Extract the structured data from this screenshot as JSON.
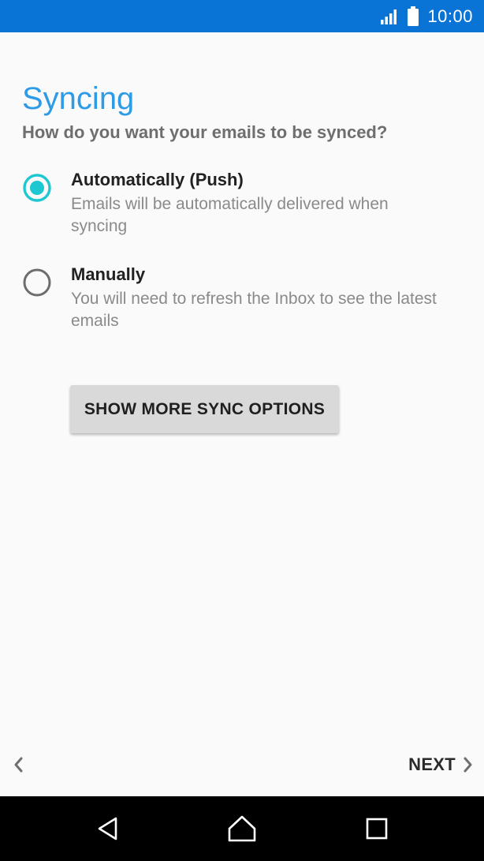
{
  "status_bar": {
    "time": "10:00",
    "signal_icon": "signal-icon",
    "battery_icon": "battery-icon"
  },
  "header": {
    "title": "Syncing",
    "subtitle": "How do you want your emails to be synced?"
  },
  "options": [
    {
      "title": "Automatically (Push)",
      "description": "Emails will be automatically delivered when syncing",
      "selected": true
    },
    {
      "title": "Manually",
      "description": "You will need to refresh the Inbox to see the latest emails",
      "selected": false
    }
  ],
  "more_button": {
    "label": "SHOW MORE SYNC OPTIONS"
  },
  "footer": {
    "back_icon": "chevron-left-icon",
    "next_label": "NEXT",
    "next_icon": "chevron-right-icon"
  },
  "nav_bar": {
    "back_icon": "nav-back-icon",
    "home_icon": "nav-home-icon",
    "recent_icon": "nav-recent-apps-icon"
  },
  "colors": {
    "status_bar": "#0a74d6",
    "accent": "#1ec8d2",
    "title": "#2d9be6"
  }
}
